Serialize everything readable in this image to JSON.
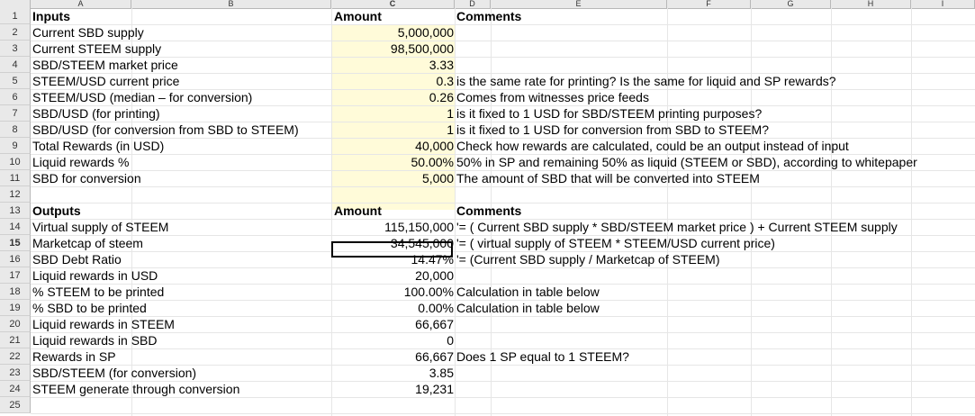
{
  "columns": [
    "A",
    "B",
    "C",
    "D",
    "E",
    "F",
    "G",
    "H",
    "I"
  ],
  "row_numbers": [
    "1",
    "2",
    "3",
    "4",
    "5",
    "6",
    "7",
    "8",
    "9",
    "10",
    "11",
    "12",
    "13",
    "14",
    "15",
    "16",
    "17",
    "18",
    "19",
    "20",
    "21",
    "22",
    "23",
    "24",
    "25"
  ],
  "selected_row": "15",
  "rows": [
    {
      "label": "Inputs",
      "amount": "Amount",
      "comment": "Comments",
      "header": true
    },
    {
      "label": "Current SBD supply",
      "amount": "5,000,000",
      "comment": ""
    },
    {
      "label": "Current STEEM supply",
      "amount": "98,500,000",
      "comment": ""
    },
    {
      "label": "SBD/STEEM market price",
      "amount": "3.33",
      "comment": ""
    },
    {
      "label": "STEEM/USD current price",
      "amount": "0.3",
      "comment": "is the same rate for printing? Is the same for liquid and SP rewards?"
    },
    {
      "label": "STEEM/USD (median – for conversion)",
      "amount": "0.26",
      "comment": "Comes from witnesses price feeds"
    },
    {
      "label": "SBD/USD (for printing)",
      "amount": "1",
      "comment": "is it fixed to 1 USD for SBD/STEEM printing purposes?"
    },
    {
      "label": "SBD/USD (for conversion from SBD to STEEM)",
      "amount": "1",
      "comment": "is it fixed to 1 USD for conversion from SBD to STEEM?"
    },
    {
      "label": "Total Rewards (in USD)",
      "amount": "40,000",
      "comment": "Check how rewards are calculated, could be an output instead of input"
    },
    {
      "label": "Liquid rewards %",
      "amount": "50.00%",
      "comment": "50% in SP and remaining 50% as liquid (STEEM or SBD), according to whitepaper"
    },
    {
      "label": "SBD for conversion",
      "amount": "5,000",
      "comment": "The amount of SBD that will be converted into STEEM"
    },
    {
      "label": "",
      "amount": "",
      "comment": ""
    },
    {
      "label": "Outputs",
      "amount": "Amount",
      "comment": "Comments",
      "header": true
    },
    {
      "label": "Virtual supply of STEEM",
      "amount": "115,150,000",
      "comment": "'=  ( Current SBD supply * SBD/STEEM market price ) + Current STEEM supply"
    },
    {
      "label": "Marketcap of steem",
      "amount": "34,545,000",
      "comment": "'= ( virtual supply of STEEM * STEEM/USD current price)"
    },
    {
      "label": "SBD Debt Ratio",
      "amount": "14.47%",
      "comment": "'= (Current SBD supply / Marketcap of STEEM)"
    },
    {
      "label": "Liquid rewards in USD",
      "amount": "20,000",
      "comment": ""
    },
    {
      "label": "% STEEM to be printed",
      "amount": "100.00%",
      "comment": "Calculation in table below"
    },
    {
      "label": "% SBD to be printed",
      "amount": "0.00%",
      "comment": "Calculation in table below"
    },
    {
      "label": "Liquid rewards in STEEM",
      "amount": "66,667",
      "comment": ""
    },
    {
      "label": "Liquid rewards in SBD",
      "amount": "0",
      "comment": ""
    },
    {
      "label": "Rewards in SP",
      "amount": "66,667",
      "comment": "Does 1 SP equal to 1 STEEM?"
    },
    {
      "label": "SBD/STEEM (for conversion)",
      "amount": "3.85",
      "comment": ""
    },
    {
      "label": "STEEM generate through conversion",
      "amount": "19,231",
      "comment": ""
    },
    {
      "label": "",
      "amount": "",
      "comment": ""
    }
  ]
}
